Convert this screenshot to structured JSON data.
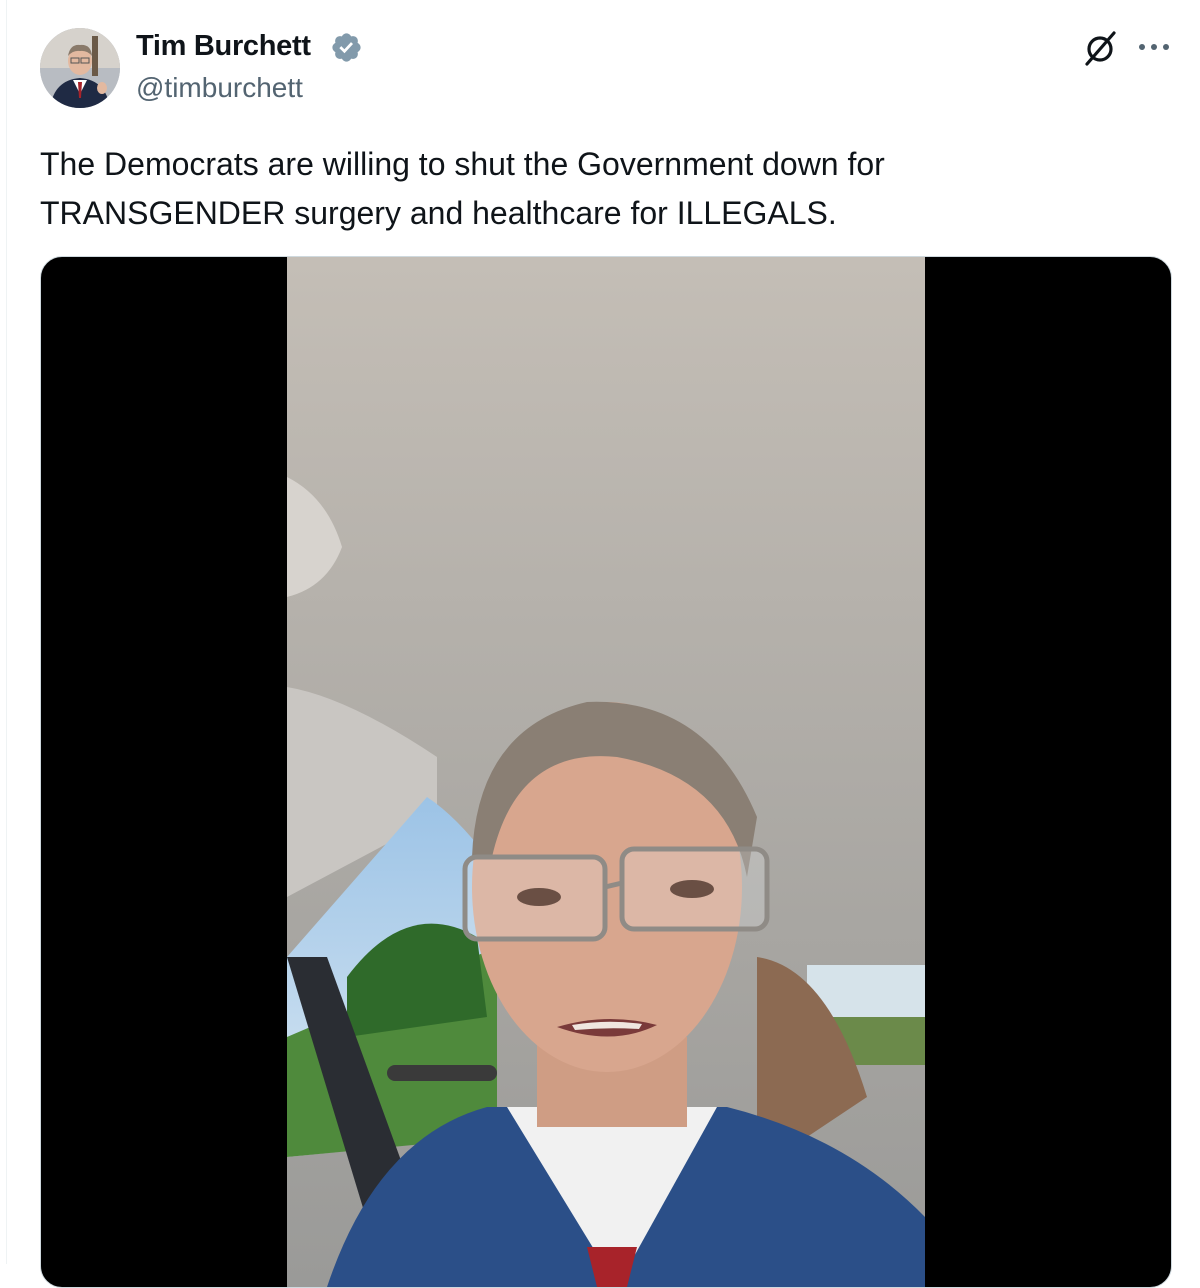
{
  "author": {
    "name": "Tim Burchett",
    "handle": "@timburchett",
    "verified": true,
    "avatar_icon": "profile-photo"
  },
  "tweet": {
    "text": "The Democrats are willing to shut the Government down for\nTRANSGENDER surgery and healthcare for ILLEGALS."
  },
  "actions": {
    "grok_icon": "grok-icon",
    "more_icon": "more-options-icon"
  },
  "media": {
    "type": "video",
    "thumbnail_icon": "video-thumbnail"
  },
  "colors": {
    "text_primary": "#0f1419",
    "text_secondary": "#536471",
    "verified_badge": "#829aab",
    "border": "#cfd9de"
  }
}
